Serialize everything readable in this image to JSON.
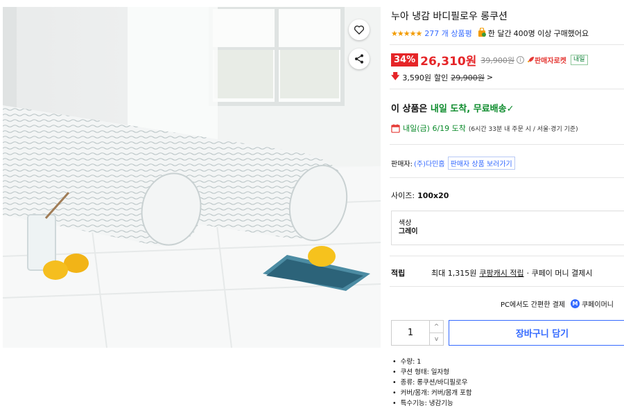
{
  "product": {
    "title": "누아 냉감 바디필로우 롱쿠션",
    "stars": "★★★★★",
    "review_count": "277 개 상품평",
    "month_text_pre": "한 달간",
    "month_buyers": "400명 이상",
    "month_text_post": "구매했어요"
  },
  "price": {
    "discount_rate": "34%",
    "sale_price": "26,310원",
    "original_price": "39,900원",
    "info_symbol": "i",
    "rocket_label": "판매자로켓",
    "tomorrow_tag": "내일",
    "coupon_amount": "3,590원",
    "coupon_label": "할인",
    "coupon_base_price": "29,900원",
    "coupon_chevron": ">"
  },
  "shipping": {
    "headline_pre": "이 상품은",
    "headline_green": "내일 도착, 무료배송",
    "check": "✓",
    "arrival_green": "내일(금) 6/19 도착",
    "arrival_detail": "(6시간 33분 내 주문 시 / 서울·경기 기준)"
  },
  "seller": {
    "label": "판매자:",
    "name": "(주)다민홈",
    "link": "판매자 상품 보러가기"
  },
  "options": {
    "size_label": "사이즈:",
    "size_value": "100x20",
    "color_label": "색상",
    "color_value": "그레이"
  },
  "reward": {
    "label": "적립",
    "pre": "최대 1,315원",
    "link": "쿠팡캐시 적립",
    "post": "· 쿠페이 머니 결제시"
  },
  "pay": {
    "pc_text": "PC에서도 간편한 결제",
    "m_badge": "M",
    "coupay": "쿠페이머니"
  },
  "cart": {
    "quantity": "1",
    "up": "^",
    "down": "v",
    "add_to_cart": "장바구니 담기"
  },
  "specs": [
    "수량: 1",
    "쿠션 형태: 일자형",
    "종류: 롱쿠션/바디필로우",
    "커버/몸개: 커버/몸개 포함",
    "특수기능: 냉감기능"
  ],
  "colors": {
    "accent_blue": "#346aff",
    "sale_red": "#e52528",
    "delivery_green": "#0a8a2a",
    "star_orange": "#f29b00"
  },
  "icons": [
    "heart-icon",
    "share-icon",
    "shopping-bag-icon",
    "rocket-icon",
    "calendar-icon",
    "down-arrow-icon",
    "check-icon"
  ]
}
